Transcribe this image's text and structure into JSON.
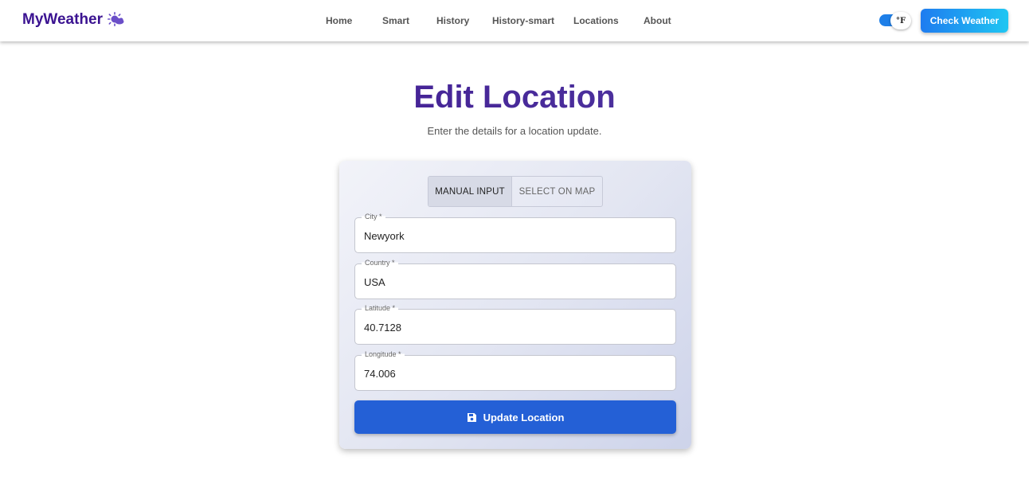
{
  "brand": {
    "name": "MyWeather",
    "icon": "weather-sun-cloud-icon"
  },
  "nav": {
    "items": [
      {
        "label": "Home"
      },
      {
        "label": "Smart"
      },
      {
        "label": "History"
      },
      {
        "label": "History-smart"
      },
      {
        "label": "Locations"
      },
      {
        "label": "About"
      }
    ]
  },
  "unit_toggle": {
    "label": "°F",
    "enabled": true
  },
  "cta": {
    "label": "Check Weather"
  },
  "page": {
    "title": "Edit Location",
    "subtitle": "Enter the details for a location update."
  },
  "form": {
    "tabs": [
      {
        "label": "MANUAL INPUT",
        "active": true
      },
      {
        "label": "SELECT ON MAP",
        "active": false
      }
    ],
    "fields": [
      {
        "label": "City *",
        "value": "Newyork"
      },
      {
        "label": "Country *",
        "value": "USA"
      },
      {
        "label": "Latitude *",
        "value": "40.7128"
      },
      {
        "label": "Longitude *",
        "value": "74.006"
      }
    ],
    "submit": {
      "label": "Update Location",
      "icon": "save-icon"
    }
  },
  "colors": {
    "brand": "#3b1391",
    "accent": "#2460d6",
    "cta_gradient_start": "#1e7cf0",
    "cta_gradient_end": "#1fc6f2"
  }
}
